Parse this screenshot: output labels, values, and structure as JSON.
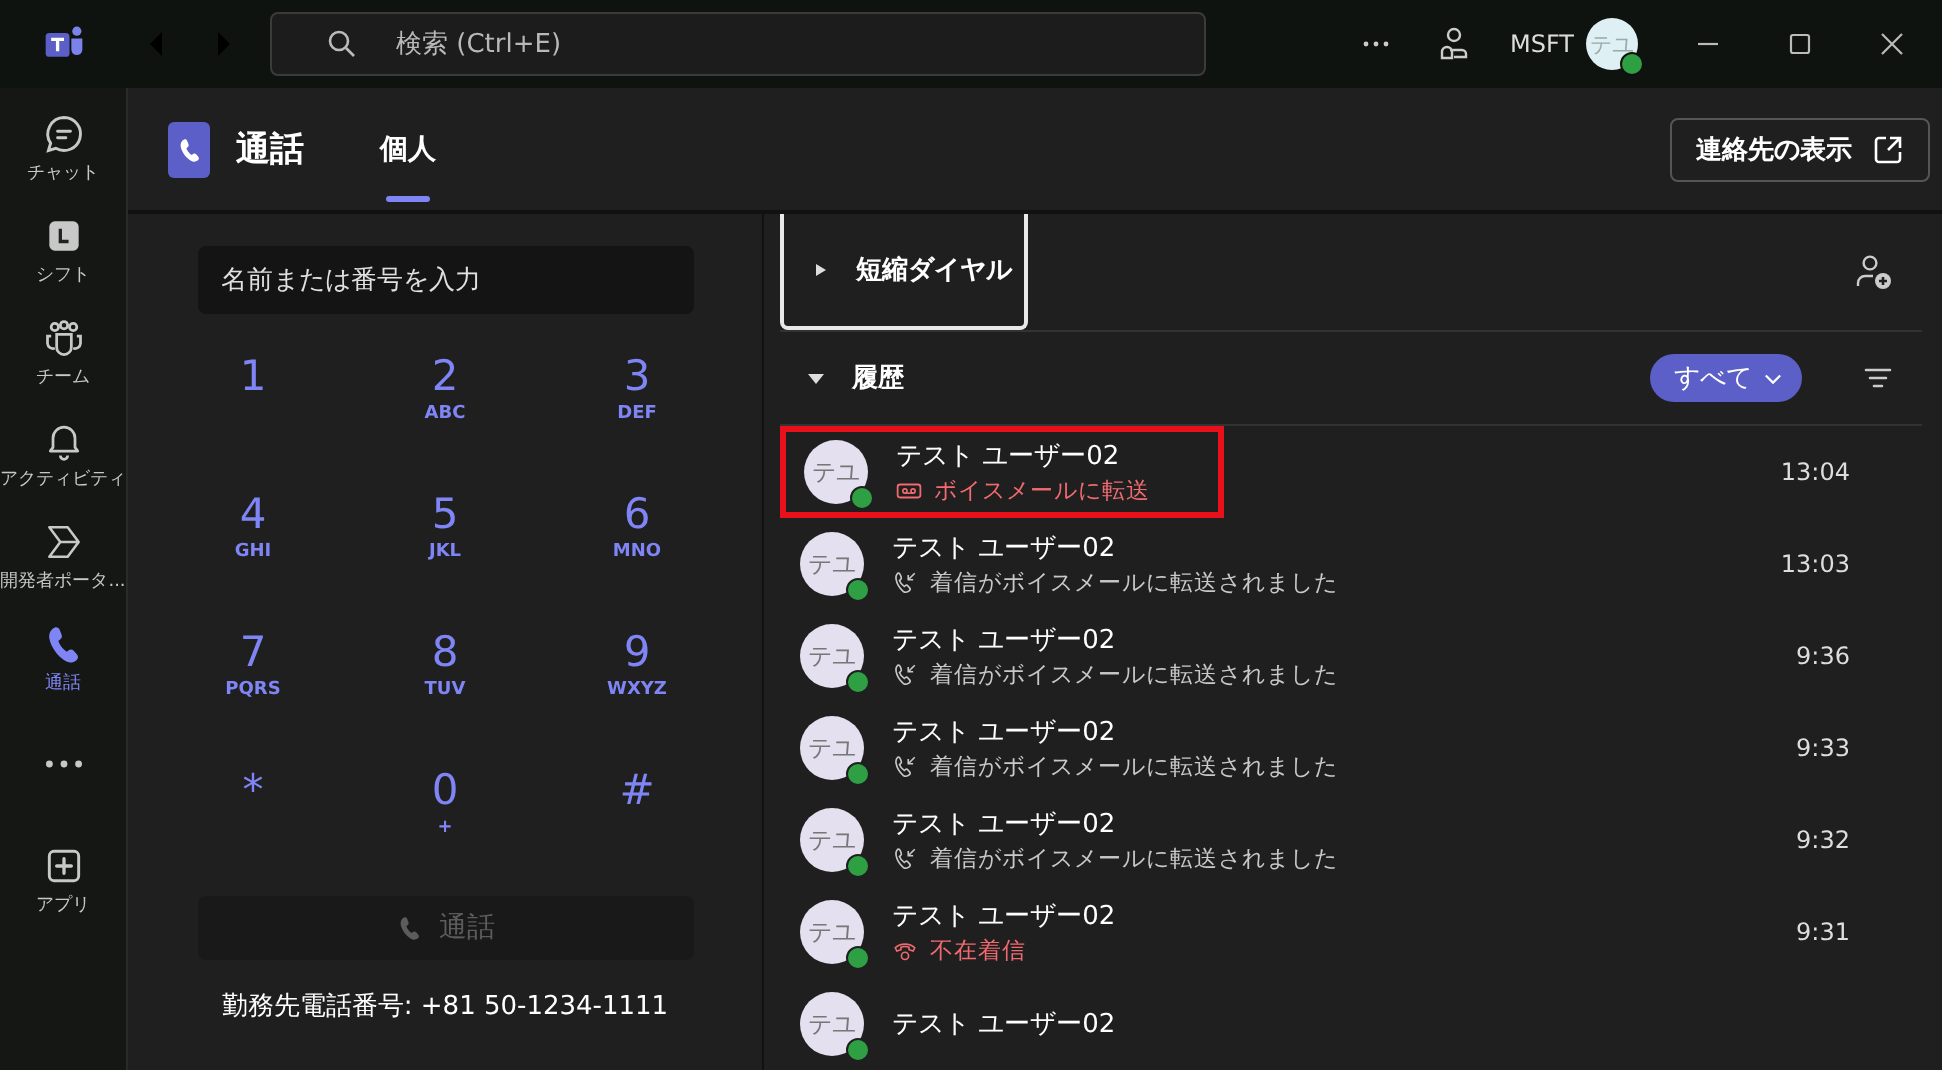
{
  "titlebar": {
    "search": {
      "placeholder": "検索 (Ctrl+E)"
    },
    "org": "MSFT",
    "avatar": "テユ",
    "online": true
  },
  "sidebar": {
    "items": [
      {
        "label": "チャット",
        "kind": "chat",
        "selected": false
      },
      {
        "label": "シフト",
        "kind": "shifts",
        "selected": false
      },
      {
        "label": "チーム",
        "kind": "teams",
        "selected": false
      },
      {
        "label": "アクティビティ",
        "kind": "bell",
        "selected": false
      },
      {
        "label": "開発者ポータ...",
        "kind": "portal",
        "selected": false
      },
      {
        "label": "通話",
        "kind": "phone",
        "selected": true
      },
      {
        "kind": "more",
        "selected": false
      },
      {
        "label": "アプリ",
        "kind": "apps",
        "selected": false
      }
    ]
  },
  "header": {
    "title": "通話",
    "tabs": [
      {
        "label": "個人",
        "selected": true
      }
    ],
    "contacts_button": "連絡先の表示"
  },
  "dialpad": {
    "input": {
      "placeholder": "名前または番号を入力"
    },
    "keys": [
      {
        "digit": "1"
      },
      {
        "digit": "2",
        "letters": "ABC"
      },
      {
        "digit": "3",
        "letters": "DEF"
      },
      {
        "digit": "4",
        "letters": "GHI"
      },
      {
        "digit": "5",
        "letters": "JKL"
      },
      {
        "digit": "6",
        "letters": "MNO"
      },
      {
        "digit": "7",
        "letters": "PQRS"
      },
      {
        "digit": "8",
        "letters": "TUV"
      },
      {
        "digit": "9",
        "letters": "WXYZ"
      },
      {
        "digit": "*"
      },
      {
        "digit": "0",
        "letters": "+"
      },
      {
        "digit": "#"
      }
    ],
    "call_button": {
      "label": "通話",
      "disabled": true
    },
    "work_number": "勤務先電話番号: +81 50-1234-1111"
  },
  "speed_dial": {
    "label": "短縮ダイヤル",
    "expanded": false,
    "focused": true
  },
  "history": {
    "label": "履歴",
    "expanded": true,
    "filter": "すべて",
    "rows": [
      {
        "initials": "テユ",
        "name": "テスト ユーザー02",
        "kind": "voicemail",
        "detail": "ボイスメールに転送",
        "time": "13:04",
        "highlighted": true
      },
      {
        "initials": "テユ",
        "name": "テスト ユーザー02",
        "kind": "forwarded",
        "detail": "着信がボイスメールに転送されました",
        "time": "13:03",
        "highlighted": false
      },
      {
        "initials": "テユ",
        "name": "テスト ユーザー02",
        "kind": "forwarded",
        "detail": "着信がボイスメールに転送されました",
        "time": "9:36",
        "highlighted": false
      },
      {
        "initials": "テユ",
        "name": "テスト ユーザー02",
        "kind": "forwarded",
        "detail": "着信がボイスメールに転送されました",
        "time": "9:33",
        "highlighted": false
      },
      {
        "initials": "テユ",
        "name": "テスト ユーザー02",
        "kind": "forwarded",
        "detail": "着信がボイスメールに転送されました",
        "time": "9:32",
        "highlighted": false
      },
      {
        "initials": "テユ",
        "name": "テスト ユーザー02",
        "kind": "missed",
        "detail": "不在着信",
        "time": "9:31",
        "highlighted": false
      },
      {
        "initials": "テユ",
        "name": "テスト ユーザー02",
        "kind": "partial",
        "highlighted": false
      }
    ]
  }
}
